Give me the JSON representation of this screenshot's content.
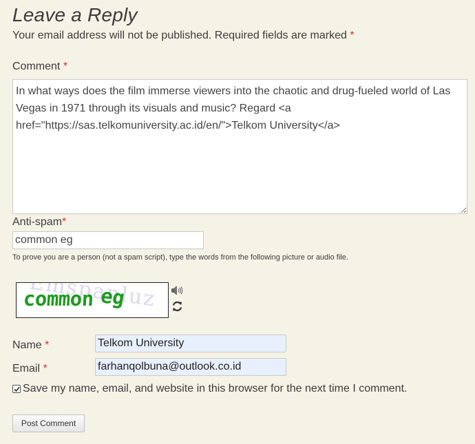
{
  "reply": {
    "title": "Leave a Reply",
    "notes": "Your email address will not be published. Required fields are marked",
    "required_mark": "*"
  },
  "comment": {
    "label": "Comment",
    "value": "In what ways does the film immerse viewers into the chaotic and drug-fueled world of Las Vegas in 1971 through its visuals and music? Regard <a href=\"https://sas.telkomuniversity.ac.id/en/\">Telkom University</a>"
  },
  "antispam": {
    "label": "Anti-spam",
    "value": "common eg",
    "help": "To prove you are a person (not a spam script), type the words from the following picture or audio file.",
    "captcha_word_1": "common",
    "captcha_word_2": "eg",
    "captcha_noise": "Emspanluz",
    "audio_icon": "speaker-icon",
    "refresh_icon": "refresh-icon"
  },
  "author": {
    "label": "Name",
    "value": "Telkom University"
  },
  "email": {
    "label": "Email",
    "value": "farhanqolbuna@outlook.co.id"
  },
  "cookies": {
    "label": "Save my name, email, and website in this browser for the next time I comment.",
    "checked": true
  },
  "submit": {
    "label": "Post Comment"
  },
  "colors": {
    "background": "#f5f2e6",
    "required": "#cc3333",
    "captcha_text": "#1e9b1e",
    "autofill": "#e8f0fe"
  }
}
